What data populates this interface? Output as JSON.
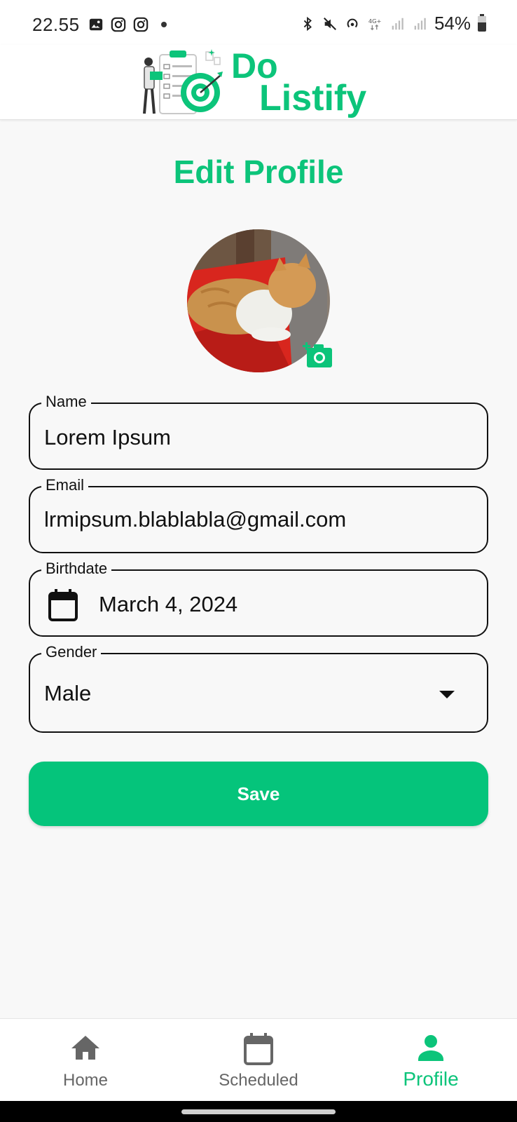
{
  "status_bar": {
    "time": "22.55",
    "battery": "54%",
    "icons_left": [
      "gallery-icon",
      "instagram-icon",
      "instagram-icon",
      "dot"
    ],
    "icons_right": [
      "bluetooth-icon",
      "mute-icon",
      "hotspot-icon",
      "4g-icon",
      "signal-icon",
      "signal-icon",
      "battery-icon"
    ]
  },
  "app": {
    "logo_line1": "Do",
    "logo_line2": "Listify",
    "accent_color": "#0cc47a"
  },
  "page": {
    "title": "Edit Profile"
  },
  "form": {
    "name_label": "Name",
    "name_value": "Lorem Ipsum",
    "email_label": "Email",
    "email_value": "lrmipsum.blablabla@gmail.com",
    "birthdate_label": "Birthdate",
    "birthdate_value": "March 4, 2024",
    "gender_label": "Gender",
    "gender_value": "Male",
    "save_label": "Save"
  },
  "bottom_nav": {
    "items": [
      {
        "label": "Home",
        "icon": "home-icon",
        "active": false
      },
      {
        "label": "Scheduled",
        "icon": "calendar-icon",
        "active": false
      },
      {
        "label": "Profile",
        "icon": "person-icon",
        "active": true
      }
    ]
  }
}
